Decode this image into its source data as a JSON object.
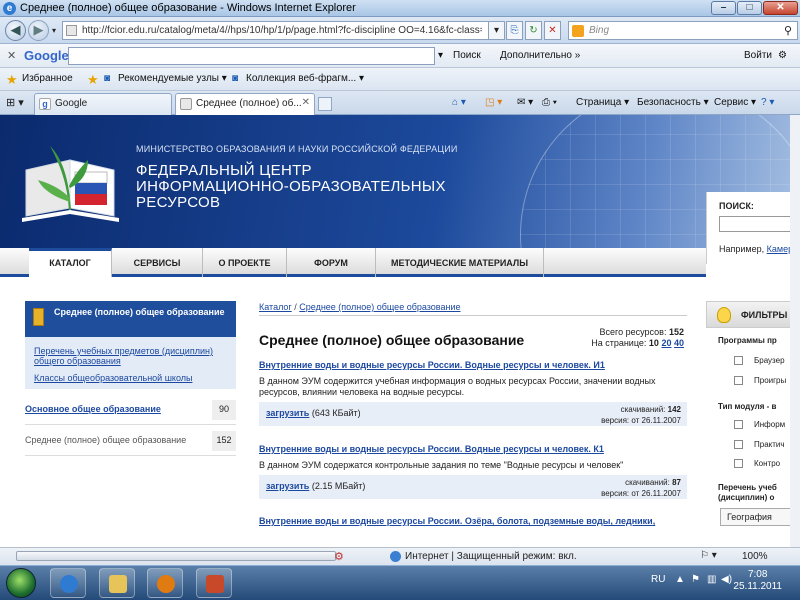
{
  "window": {
    "title": "Среднее (полное) общее образование - Windows Internet Explorer"
  },
  "address": {
    "url": "http://fcior.edu.ru/catalog/meta/4//hps/10/hp/1/p/page.html?fc-discipline OO=4.16&fc-class=8",
    "search_placeholder": "Bing"
  },
  "google_toolbar": {
    "brand": "Google",
    "search_label": "Поиск",
    "more_label": "Дополнительно »",
    "signin_label": "Войти"
  },
  "favorites": {
    "favorites_label": "Избранное",
    "items": [
      "Рекомендуемые узлы ▾",
      "Коллекция веб-фрагм... ▾"
    ]
  },
  "tabs": [
    {
      "label": "Google"
    },
    {
      "label": "Среднее (полное) об..."
    }
  ],
  "command_bar": {
    "page": "Страница ▾",
    "safety": "Безопасность ▾",
    "tools": "Сервис ▾"
  },
  "site": {
    "ministry": "МИНИСТЕРСТВО ОБРАЗОВАНИЯ И НАУКИ РОССИЙСКОЙ ФЕДЕРАЦИИ",
    "name": "ФЕДЕРАЛЬНЫЙ ЦЕНТР ИНФОРМАЦИОННО-ОБРАЗОВАТЕЛЬНЫХ РЕСУРСОВ",
    "menu": [
      "КАТАЛОГ",
      "СЕРВИСЫ",
      "О ПРОЕКТЕ",
      "ФОРУМ",
      "МЕТОДИЧЕСКИЕ МАТЕРИАЛЫ"
    ],
    "search_label": "ПОИСК:",
    "search_example_prefix": "Например,",
    "search_example_link": "Камера"
  },
  "left": {
    "head": "Среднее (полное) общее образование",
    "links": [
      "Перечень учебных предметов (дисциплин) общего образования",
      "Классы общеобразовательной школы"
    ],
    "levels": [
      {
        "name": "Основное общее образование",
        "count": "90"
      },
      {
        "name": "Среднее (полное) общее образование",
        "count": "152"
      }
    ]
  },
  "main": {
    "crumbs": [
      "Каталог",
      "/",
      "Среднее (полное) общее образование"
    ],
    "title": "Среднее (полное) общее образование",
    "total_label": "Всего ресурсов:",
    "total": "152",
    "per_page_label": "На странице:",
    "per_page": [
      "10",
      "20",
      "40"
    ],
    "results": [
      {
        "title": "Внутренние воды и водные ресурсы России. Водные ресурсы и человек. И1",
        "desc": "В данном ЭУМ содержится учебная информация о водных ресурсах России, значении водных ресурсов, влиянии человека на водные ресурсы.",
        "download": "загрузить",
        "size": "(643 КБайт)",
        "downloads_label": "скачиваний:",
        "downloads": "142",
        "version_label": "версия: от",
        "version": "26.11.2007"
      },
      {
        "title": "Внутренние воды и водные ресурсы России. Водные ресурсы и человек. К1",
        "desc": "В данном ЭУМ содержатся контрольные задания по теме \"Водные ресурсы и человек\"",
        "download": "загрузить",
        "size": "(2.15 МБайт)",
        "downloads_label": "скачиваний:",
        "downloads": "87",
        "version_label": "версия: от",
        "version": "26.11.2007"
      },
      {
        "title": "Внутренние воды и водные ресурсы России. Озёра, болота, подземные воды, ледники,"
      }
    ]
  },
  "filters": {
    "title": "ФИЛЬТРЫ",
    "groups": [
      {
        "label": "Программы пр",
        "items": [
          "Браузер",
          "Проигры"
        ]
      },
      {
        "label": "Тип модуля - в",
        "items": [
          "Информ",
          "Практич",
          "Контро"
        ]
      }
    ],
    "list_label_1": "Перечень учеб",
    "list_label_2": "(дисциплин) о",
    "list_value": "География"
  },
  "status": {
    "zone": "Интернет | Защищенный режим: вкл.",
    "zoom": "100%"
  },
  "taskbar": {
    "lang": "RU",
    "time": "7:08",
    "date": "25.11.2011"
  }
}
